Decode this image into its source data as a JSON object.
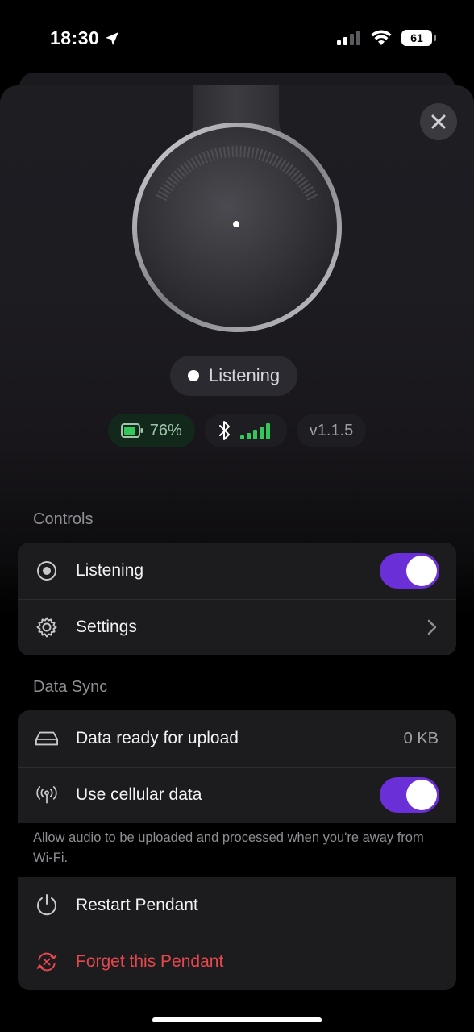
{
  "status_bar": {
    "time": "18:30",
    "battery": "61"
  },
  "device": {
    "status": "Listening",
    "battery_percent": "76%",
    "firmware_version": "v1.1.5"
  },
  "controls": {
    "section_title": "Controls",
    "listening_label": "Listening",
    "listening_on": true,
    "settings_label": "Settings"
  },
  "data_sync": {
    "section_title": "Data Sync",
    "upload_label": "Data ready for upload",
    "upload_value": "0 KB",
    "cellular_label": "Use cellular data",
    "cellular_on": true,
    "footnote": "Allow audio to be uploaded and processed when you're away from Wi-Fi."
  },
  "actions": {
    "restart_label": "Restart Pendant",
    "forget_label": "Forget this Pendant"
  },
  "colors": {
    "accent": "#6a2fd6",
    "danger": "#e5484d",
    "battery_green": "#34c759"
  }
}
